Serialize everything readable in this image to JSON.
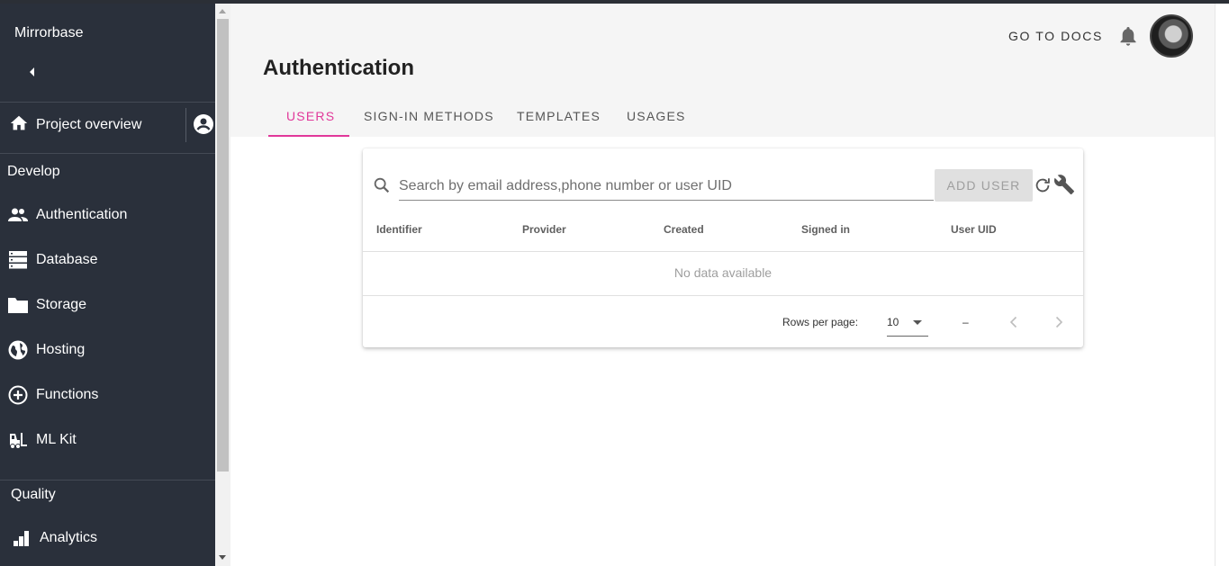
{
  "app": {
    "name": "Mirrorbase"
  },
  "sidebar": {
    "overview_label": "Project overview",
    "sections": {
      "develop": "Develop",
      "quality": "Quality"
    },
    "items": [
      {
        "label": "Authentication",
        "icon": "people-icon"
      },
      {
        "label": "Database",
        "icon": "database-icon"
      },
      {
        "label": "Storage",
        "icon": "folder-icon"
      },
      {
        "label": "Hosting",
        "icon": "globe-icon"
      },
      {
        "label": "Functions",
        "icon": "functions-icon"
      },
      {
        "label": "ML Kit",
        "icon": "ml-kit-icon"
      },
      {
        "label": "Analytics",
        "icon": "analytics-icon"
      }
    ]
  },
  "header": {
    "docs_label": "GO TO DOCS",
    "page_title": "Authentication",
    "tabs": [
      {
        "label": "USERS",
        "active": true
      },
      {
        "label": "SIGN-IN METHODS",
        "active": false
      },
      {
        "label": "TEMPLATES",
        "active": false
      },
      {
        "label": "USAGES",
        "active": false
      }
    ]
  },
  "users_table": {
    "search_placeholder": "Search by email address,phone number or user UID",
    "add_user_label": "ADD USER",
    "columns": [
      "Identifier",
      "Provider",
      "Created",
      "Signed in",
      "User UID"
    ],
    "empty_text": "No data available",
    "rows_per_page_label": "Rows per page:",
    "rows_per_page_value": "10",
    "range_text": "–"
  },
  "colors": {
    "accent": "#e1389a",
    "sidebar_bg": "#2a303b"
  }
}
